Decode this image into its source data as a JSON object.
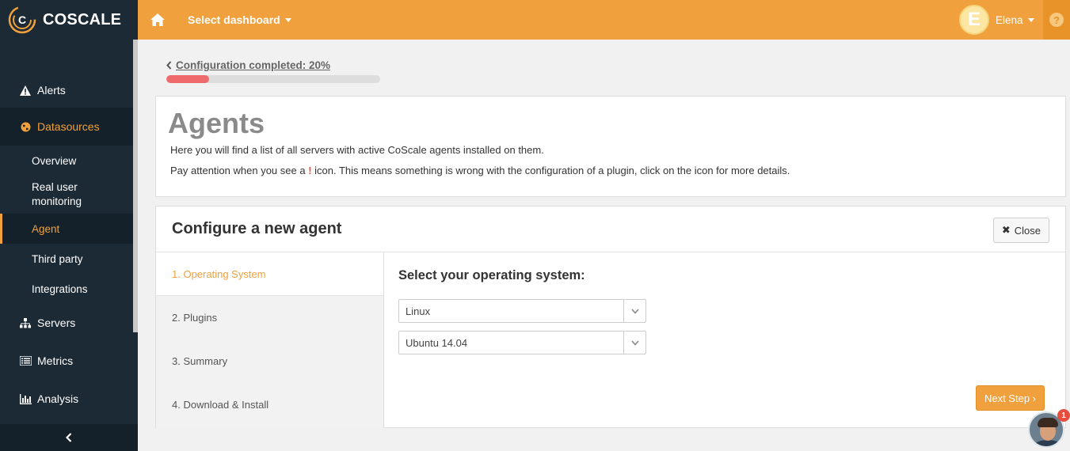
{
  "brand": {
    "name": "COSCALE",
    "accent": "#f0a03c",
    "sidebar_bg": "#1c2a35"
  },
  "topbar": {
    "dashboard_select": "Select dashboard",
    "user_initial": "E",
    "user_name": "Elena",
    "help_icon": "question-icon",
    "home_icon": "home-icon"
  },
  "sidebar": {
    "items": [
      {
        "label": "Alerts",
        "icon": "warning-icon"
      },
      {
        "label": "Datasources",
        "icon": "globe-icon",
        "active": true
      },
      {
        "label": "Servers",
        "icon": "sitemap-icon"
      },
      {
        "label": "Metrics",
        "icon": "list-icon"
      },
      {
        "label": "Analysis",
        "icon": "bar-chart-icon"
      }
    ],
    "subitems": [
      {
        "label": "Overview"
      },
      {
        "label": "Real user monitoring"
      },
      {
        "label": "Agent",
        "active": true
      },
      {
        "label": "Third party"
      },
      {
        "label": "Integrations"
      }
    ]
  },
  "progress": {
    "label": "Configuration completed: 20%",
    "percent": 20
  },
  "agents": {
    "title": "Agents",
    "line1": "Here you will find a list of all servers with active CoScale agents installed on them.",
    "line2_pre": "Pay attention when you see a ",
    "line2_mark": "!",
    "line2_post": " icon. This means something is wrong with the configuration of a plugin, click on the icon for more details."
  },
  "config": {
    "title": "Configure a new agent",
    "close_label": "Close",
    "steps": [
      "1. Operating System",
      "2. Plugins",
      "3. Summary",
      "4. Download & Install"
    ],
    "os_heading": "Select your operating system:",
    "os_family": "Linux",
    "os_version": "Ubuntu 14.04",
    "next_label": "Next Step ›"
  },
  "chat": {
    "badge": "1"
  }
}
